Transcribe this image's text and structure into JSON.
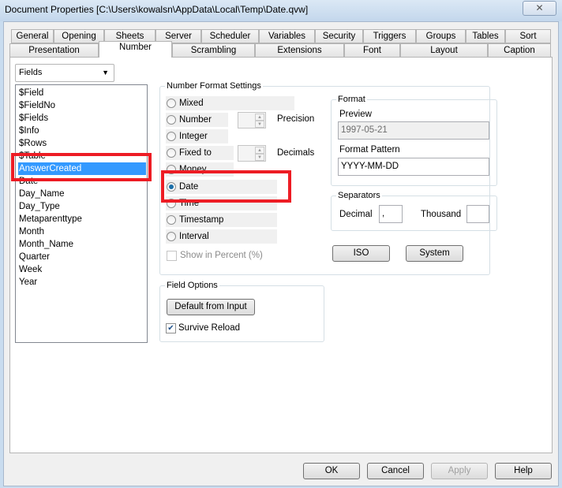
{
  "window": {
    "title": "Document Properties [C:\\Users\\kowalsn\\AppData\\Local\\Temp\\Date.qvw]",
    "close": "✕"
  },
  "tabs_row1": [
    "General",
    "Opening",
    "Sheets",
    "Server",
    "Scheduler",
    "Variables",
    "Security",
    "Triggers",
    "Groups",
    "Tables",
    "Sort"
  ],
  "tabs_row2": [
    "Presentation",
    "Number",
    "Scrambling",
    "Extensions",
    "Font",
    "Layout",
    "Caption"
  ],
  "selected_tab": "Number",
  "fields_combo": {
    "value": "Fields",
    "arrow": "▼"
  },
  "field_list": {
    "items": [
      "$Field",
      "$FieldNo",
      "$Fields",
      "$Info",
      "$Rows",
      "$Table",
      "AnswerCreated",
      "Date",
      "Day_Name",
      "Day_Type",
      "Metaparenttype",
      "Month",
      "Month_Name",
      "Quarter",
      "Week",
      "Year"
    ],
    "selected": "AnswerCreated"
  },
  "number_format": {
    "title": "Number Format Settings",
    "options": [
      "Mixed",
      "Number",
      "Integer",
      "Fixed to",
      "Money",
      "Date",
      "Time",
      "Timestamp",
      "Interval"
    ],
    "selected": "Date",
    "precision_label": "Precision",
    "decimals_label": "Decimals",
    "show_percent": "Show in Percent (%)"
  },
  "format": {
    "title": "Format",
    "preview_label": "Preview",
    "preview_value": "1997-05-21",
    "pattern_label": "Format Pattern",
    "pattern_value": "YYYY-MM-DD"
  },
  "separators": {
    "title": "Separators",
    "decimal_label": "Decimal",
    "decimal_value": ",",
    "thousand_label": "Thousand",
    "thousand_value": ""
  },
  "buttons": {
    "iso": "ISO",
    "system": "System",
    "default_from_input": "Default from Input",
    "ok": "OK",
    "cancel": "Cancel",
    "apply": "Apply",
    "help": "Help"
  },
  "field_options": {
    "title": "Field Options",
    "survive_reload": "Survive Reload",
    "survive_checked": true
  },
  "highlight_color": "#ed1c24"
}
